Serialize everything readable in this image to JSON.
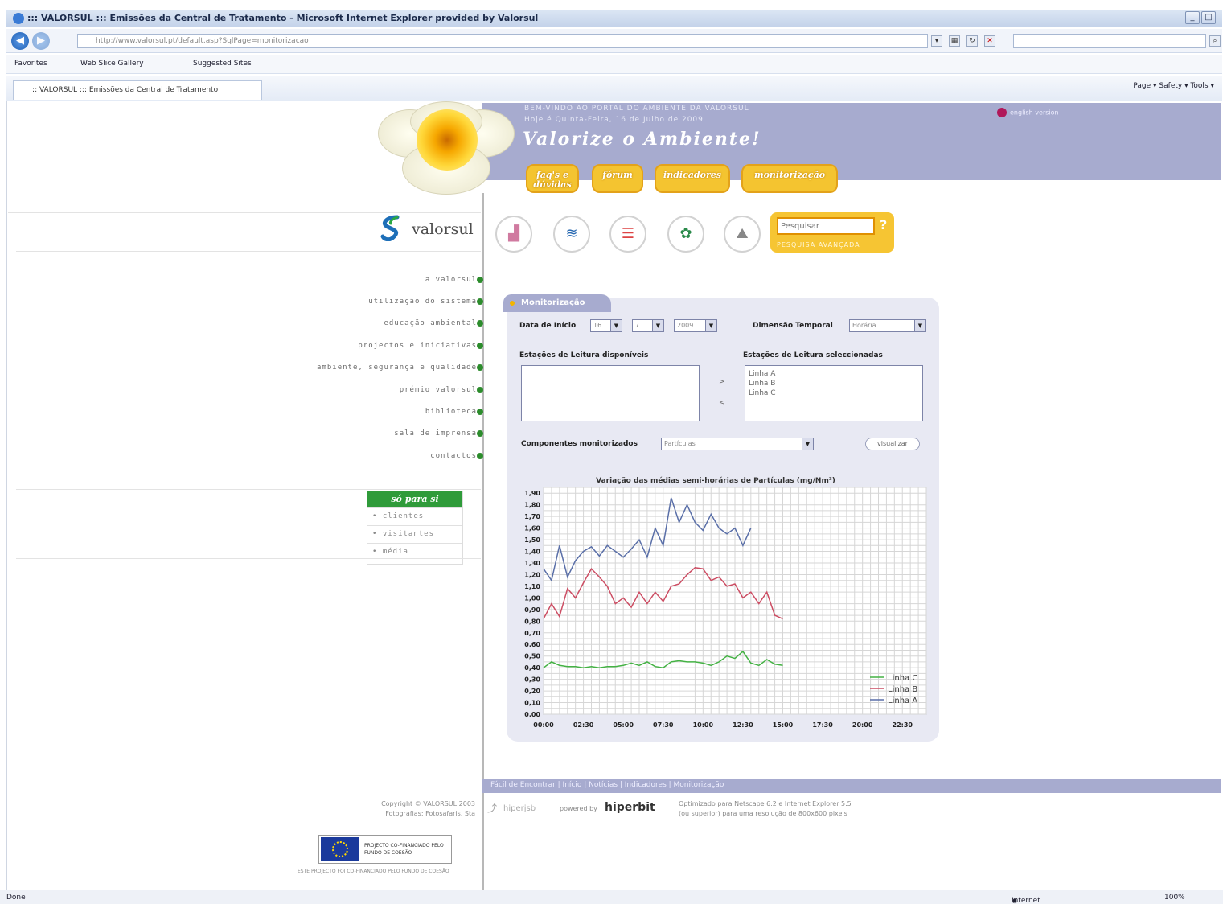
{
  "browser": {
    "title": "::: VALORSUL ::: Emissões da Central de Tratamento - Microsoft Internet Explorer provided by Valorsul",
    "url": "http://www.valorsul.pt/default.asp?SqlPage=monitorizacao",
    "favorites_label": "Favorites",
    "fav_link_1": "Web Slice Gallery",
    "fav_link_2": "Suggested Sites",
    "tab_label": "::: VALORSUL ::: Emissões da Central de Tratamento",
    "command_bar": "Page ▾   Safety ▾   Tools ▾",
    "status_left": "Done",
    "status_zone": "Internet",
    "status_zoom": "100%"
  },
  "banner": {
    "line1": "BEM-VINDO AO PORTAL DO AMBIENTE DA VALORSUL",
    "line2": "Hoje é Quinta-Feira, 16 de Julho de 2009",
    "motto": "Valorize o Ambiente!",
    "language": "english version"
  },
  "topnav": {
    "item1": "faq's e dúvidas",
    "item2": "fórum",
    "item3": "indicadores",
    "item4": "monitorização"
  },
  "logo": {
    "text": "valorsul"
  },
  "search": {
    "placeholder": "Pesquisar",
    "advanced": "PESQUISA AVANÇADA"
  },
  "menu": {
    "items": [
      "a valorsul",
      "utilização do sistema",
      "educação ambiental",
      "projectos e iniciativas",
      "ambiente, segurança e qualidade",
      "prémio valorsul",
      "biblioteca",
      "sala de imprensa",
      "contactos"
    ]
  },
  "sidebox": {
    "header": "só para si",
    "items": [
      "• clientes",
      "• visitantes",
      "• média"
    ]
  },
  "panel": {
    "tab": "Monitorização",
    "start_date_label": "Data de Início",
    "day": "16",
    "month": "7",
    "year": "2009",
    "temporal_label": "Dimensão Temporal",
    "temporal_value": "Horária",
    "available_label": "Estações de Leitura disponíveis",
    "selected_label": "Estações de Leitura seleccionadas",
    "selected_items": [
      "Linha A",
      "Linha B",
      "Linha C"
    ],
    "add_arrow": ">",
    "remove_arrow": "<",
    "component_label": "Componentes monitorizados",
    "component_value": "Partículas",
    "view_button": "visualizar"
  },
  "chart_data": {
    "type": "line",
    "title": "Variação das médias semi-horárias de Partículas (mg/Nm³)",
    "xlabel": "",
    "ylabel": "",
    "x_ticks": [
      "00:00",
      "02:30",
      "05:00",
      "07:30",
      "10:00",
      "12:30",
      "15:00",
      "17:30",
      "20:00",
      "22:30"
    ],
    "y_ticks": [
      "0,00",
      "0,10",
      "0,20",
      "0,30",
      "0,40",
      "0,50",
      "0,60",
      "0,70",
      "0,80",
      "0,90",
      "1,00",
      "1,10",
      "1,20",
      "1,30",
      "1,40",
      "1,50",
      "1,60",
      "1,70",
      "1,80",
      "1,90"
    ],
    "ylim": [
      0,
      1.95
    ],
    "x_unit": "hours",
    "xlim": [
      0,
      24
    ],
    "grid": true,
    "legend_position": "bottom-right",
    "series": [
      {
        "name": "Linha C",
        "color": "#44b244",
        "x": [
          0,
          0.5,
          1,
          1.5,
          2,
          2.5,
          3,
          3.5,
          4,
          4.5,
          5,
          5.5,
          6,
          6.5,
          7,
          7.5,
          8,
          8.5,
          9,
          9.5,
          10,
          10.5,
          11,
          11.5,
          12,
          12.5,
          13,
          13.5,
          14,
          14.5,
          15
        ],
        "values": [
          0.4,
          0.45,
          0.42,
          0.41,
          0.41,
          0.4,
          0.41,
          0.4,
          0.41,
          0.41,
          0.42,
          0.44,
          0.42,
          0.45,
          0.41,
          0.4,
          0.45,
          0.46,
          0.45,
          0.45,
          0.44,
          0.42,
          0.45,
          0.5,
          0.48,
          0.54,
          0.44,
          0.42,
          0.47,
          0.43,
          0.42
        ]
      },
      {
        "name": "Linha B",
        "color": "#cc4d63",
        "x": [
          0,
          0.5,
          1,
          1.5,
          2,
          2.5,
          3,
          3.5,
          4,
          4.5,
          5,
          5.5,
          6,
          6.5,
          7,
          7.5,
          8,
          8.5,
          9,
          9.5,
          10,
          10.5,
          11,
          11.5,
          12,
          12.5,
          13,
          13.5,
          14,
          14.5,
          15
        ],
        "values": [
          0.82,
          0.95,
          0.84,
          1.08,
          1.0,
          1.13,
          1.25,
          1.18,
          1.1,
          0.95,
          1.0,
          0.92,
          1.05,
          0.95,
          1.05,
          0.97,
          1.1,
          1.12,
          1.2,
          1.26,
          1.25,
          1.15,
          1.18,
          1.1,
          1.12,
          1.0,
          1.05,
          0.95,
          1.05,
          0.85,
          0.82
        ]
      },
      {
        "name": "Linha A",
        "color": "#5a6fa8",
        "x": [
          0,
          0.5,
          1,
          1.5,
          2,
          2.5,
          3,
          3.5,
          4,
          4.5,
          5,
          5.5,
          6,
          6.5,
          7,
          7.5,
          8,
          8.5,
          9,
          9.5,
          10,
          10.5,
          11,
          11.5,
          12,
          12.5,
          13
        ],
        "values": [
          1.25,
          1.15,
          1.45,
          1.18,
          1.32,
          1.4,
          1.44,
          1.36,
          1.45,
          1.4,
          1.35,
          1.42,
          1.5,
          1.35,
          1.6,
          1.45,
          1.86,
          1.65,
          1.8,
          1.65,
          1.58,
          1.72,
          1.6,
          1.55,
          1.6,
          1.45,
          1.6
        ]
      }
    ]
  },
  "footer": {
    "nav": "Fácil de Encontrar  |  Início  |  Notícias  |  Indicadores  |  Monitorização",
    "copyright": "Copyright © VALORSUL 2003",
    "photos": "Fotografias: Fotosafaris, Sta",
    "hiper_prefix": "hiperjsb",
    "powered": "powered by",
    "hiper_brand": "hiperbit",
    "optimized1": "Optimizado para Netscape 6.2 e Internet Explorer 5.5",
    "optimized2": "(ou superior) para uma resolução de 800x600 pixels",
    "eu_text": "PROJECTO CO-FINANCIADO PELO FUNDO DE COESÃO",
    "eu_caption": "ESTE PROJECTO FOI CO-FINANCIADO PELO FUNDO DE COESÃO"
  }
}
